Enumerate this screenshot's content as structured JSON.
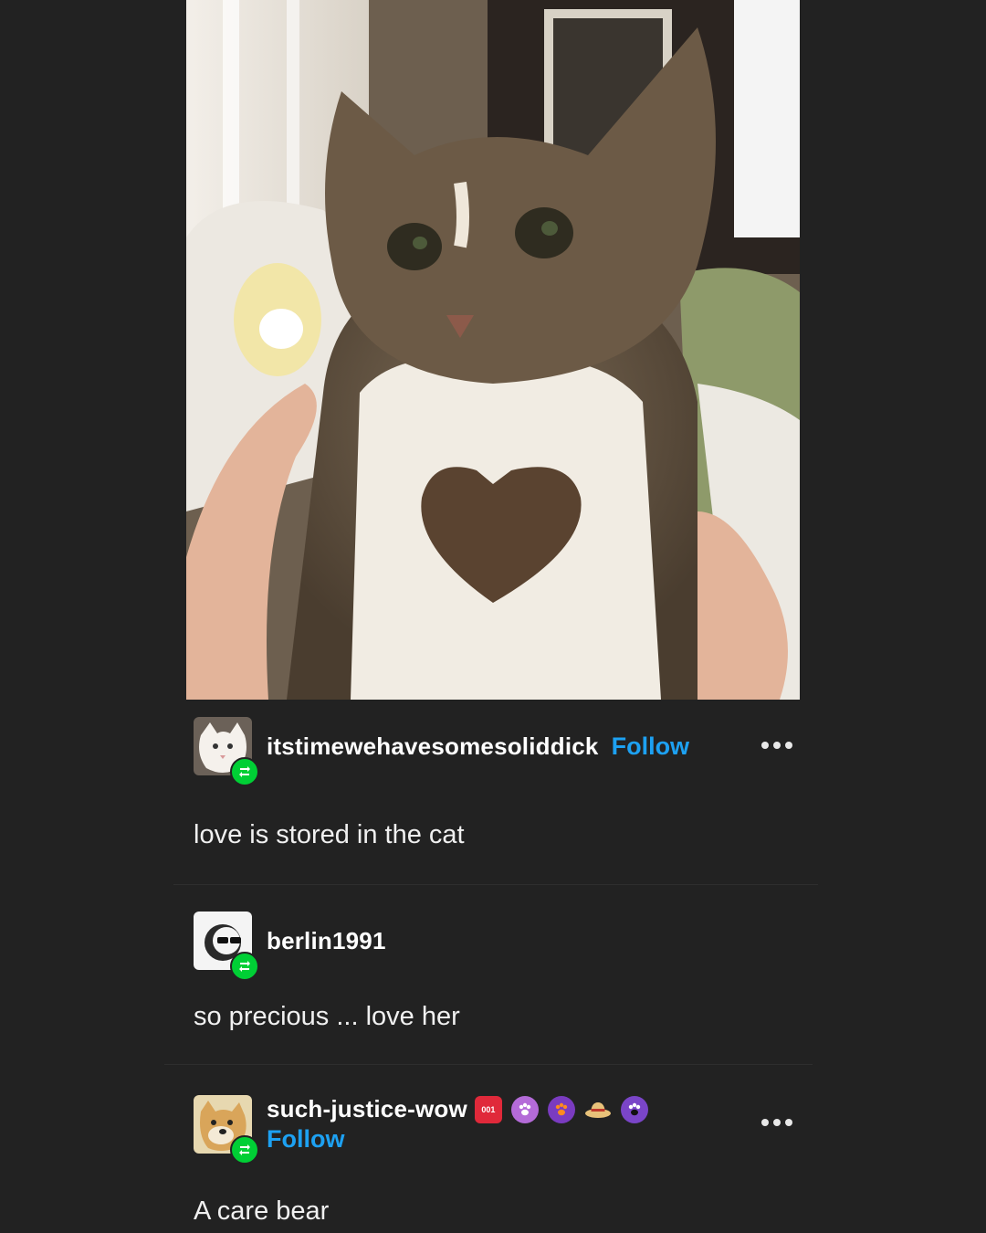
{
  "image": {
    "alt": ""
  },
  "posts": [
    {
      "username": "itstimewehavesomesoliddick",
      "follow_label": "Follow",
      "text": "love is stored in the cat",
      "avatar_icon": "cat-avatar",
      "badge_icon": "reblog-icon"
    },
    {
      "username": "berlin1991",
      "text": "so precious ... love her",
      "avatar_icon": "sunglasses-avatar",
      "badge_icon": "reblog-icon"
    },
    {
      "username": "such-justice-wow",
      "follow_label": "Follow",
      "text": "A care bear",
      "avatar_icon": "doge-avatar",
      "badge_icon": "reblog-icon",
      "badges": [
        {
          "name": "badge-001-icon",
          "label": "001",
          "color": "#e0293a"
        },
        {
          "name": "badge-paw-pink-icon",
          "color": "#b46bd8"
        },
        {
          "name": "badge-paw-orange-icon",
          "color": "#7a3bc0"
        },
        {
          "name": "badge-straw-hat-icon",
          "color": "#e8c27a"
        },
        {
          "name": "badge-paw-purple-icon",
          "color": "#7a45c8"
        }
      ]
    }
  ],
  "colors": {
    "background": "#222222",
    "accent_blue": "#1da1f2",
    "reblog_green": "#00cf35"
  }
}
